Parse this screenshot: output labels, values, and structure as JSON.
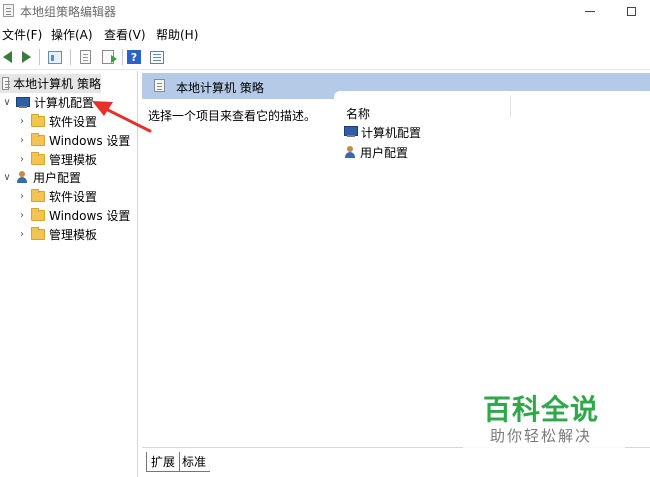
{
  "window": {
    "title": "本地组策略编辑器"
  },
  "menu": {
    "file": "文件(F)",
    "action": "操作(A)",
    "view": "查看(V)",
    "help": "帮助(H)"
  },
  "toolbar": {
    "help_glyph": "?"
  },
  "tree": {
    "root": "本地计算机 策略",
    "computer_config": "计算机配置",
    "computer_children": [
      "软件设置",
      "Windows 设置",
      "管理模板"
    ],
    "user_config": "用户配置",
    "user_children": [
      "软件设置",
      "Windows 设置",
      "管理模板"
    ],
    "expanded_glyph": "∨",
    "collapsed_glyph": "›"
  },
  "right_pane": {
    "header": "本地计算机 策略",
    "description": "选择一个项目来查看它的描述。",
    "column_name": "名称",
    "items": [
      "计算机配置",
      "用户配置"
    ]
  },
  "tabs": {
    "extended": "扩展",
    "standard": "标准"
  },
  "watermark": {
    "title": "百科全说",
    "subtitle": "助你轻松解决"
  },
  "colors": {
    "header_bg": "#b4cae6",
    "selected_bg": "#e6e6e6",
    "annotation_arrow": "#e8302a",
    "watermark_green": "#2fa84a"
  }
}
